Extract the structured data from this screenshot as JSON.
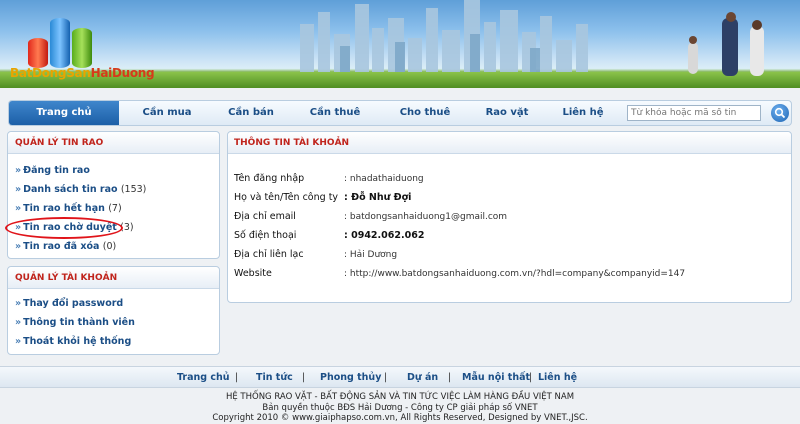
{
  "logo": {
    "part1": "BatDongSan",
    "part2": "HaiDuong"
  },
  "nav": {
    "items": [
      "Trang chủ",
      "Cần mua",
      "Cần bán",
      "Cần thuê",
      "Cho thuê",
      "Rao vặt",
      "Liên hệ"
    ],
    "search_placeholder": "Từ khóa hoặc mã số tin"
  },
  "listing_menu": {
    "title": "QUẢN LÝ TIN RAO",
    "items": [
      {
        "label": "Đăng tin rao",
        "count": ""
      },
      {
        "label": "Danh sách tin rao",
        "count": "(153)"
      },
      {
        "label": "Tin rao hết hạn",
        "count": "(7)"
      },
      {
        "label": "Tin rao chờ duyệt",
        "count": "(3)"
      },
      {
        "label": "Tin rao đã xóa",
        "count": "(0)"
      }
    ]
  },
  "account_menu": {
    "title": "QUẢN LÝ TÀI KHOẢN",
    "items": [
      "Thay đổi password",
      "Thông tin thành viên",
      "Thoát khỏi hệ thống"
    ]
  },
  "account_info": {
    "title": "THÔNG TIN TÀI KHOẢN",
    "fields": [
      {
        "label": "Tên đăng nhập",
        "value": ": nhadathaiduong"
      },
      {
        "label": "Họ và tên/Tên công ty",
        "value": ": Đỗ Như Đợi"
      },
      {
        "label": "Địa chỉ email",
        "value": ": batdongsanhaiduong1@gmail.com"
      },
      {
        "label": "Số điện thoại",
        "value": ": 0942.062.062"
      },
      {
        "label": "Địa chỉ liên lạc",
        "value": ": Hải Dương"
      },
      {
        "label": "Website",
        "value": ": http://www.batdongsanhaiduong.com.vn/?hdl=company&companyid=147"
      }
    ]
  },
  "footer": {
    "links": [
      "Trang chủ",
      "Tin tức",
      "Phong thủy",
      "Dự án",
      "Mẫu nội thất",
      "Liên hệ"
    ],
    "line1": "HỆ THỐNG RAO VẶT - BẤT ĐỘNG SẢN VÀ TIN TỨC VIỆC LÀM HÀNG ĐẦU VIỆT NAM",
    "line2": "Bản quyền thuộc BĐS Hải Dương - Công ty CP giải pháp số VNET",
    "line3": "Copyright 2010 © www.giaiphapso.com.vn, All Rights Reserved, Designed by VNET.,JSC."
  },
  "colors": {
    "accent_red": "#c0241c",
    "link_blue": "#1b4e86",
    "highlight_ring": "#e0141a"
  }
}
